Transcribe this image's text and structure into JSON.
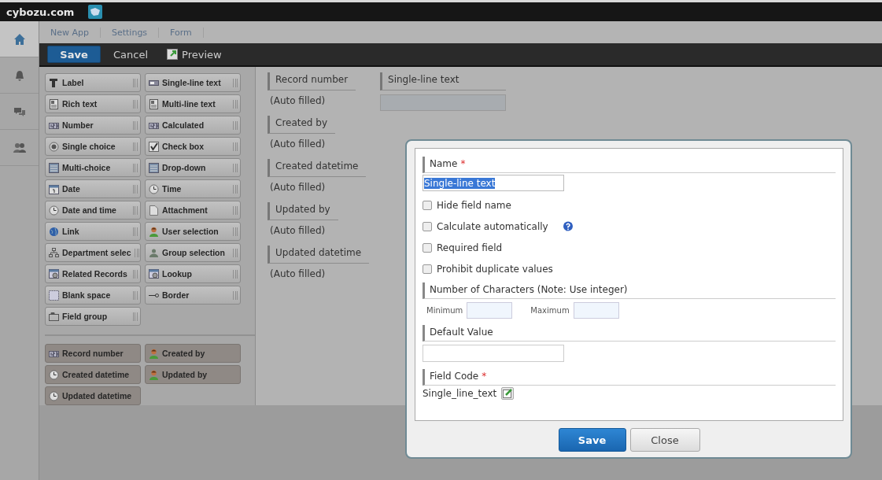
{
  "topbar": {
    "logo": "cybozu.com"
  },
  "sidenav": [
    {
      "kind": "home",
      "selected": true
    },
    {
      "kind": "bell",
      "selected": false
    },
    {
      "kind": "chat",
      "selected": false
    },
    {
      "kind": "people",
      "selected": false
    }
  ],
  "breadcrumb": [
    "New App",
    "Settings",
    "Form"
  ],
  "toolbar": {
    "save": "Save",
    "cancel": "Cancel",
    "preview": "Preview"
  },
  "palette": {
    "fields": [
      {
        "label": "Label",
        "kind": "label"
      },
      {
        "label": "Single-line text",
        "kind": "text"
      },
      {
        "label": "Rich text",
        "kind": "doc"
      },
      {
        "label": "Multi-line text",
        "kind": "doc"
      },
      {
        "label": "Number",
        "kind": "number"
      },
      {
        "label": "Calculated",
        "kind": "number"
      },
      {
        "label": "Single choice",
        "kind": "radio"
      },
      {
        "label": "Check box",
        "kind": "check"
      },
      {
        "label": "Multi-choice",
        "kind": "list"
      },
      {
        "label": "Drop-down",
        "kind": "list"
      },
      {
        "label": "Date",
        "kind": "calendar"
      },
      {
        "label": "Time",
        "kind": "clock"
      },
      {
        "label": "Date and time",
        "kind": "clock"
      },
      {
        "label": "Attachment",
        "kind": "file"
      },
      {
        "label": "Link",
        "kind": "globe"
      },
      {
        "label": "User selection",
        "kind": "person"
      },
      {
        "label": "Department selec",
        "kind": "org"
      },
      {
        "label": "Group selection",
        "kind": "group"
      },
      {
        "label": "Related Records",
        "kind": "table"
      },
      {
        "label": "Lookup",
        "kind": "table"
      },
      {
        "label": "Blank space",
        "kind": "blank"
      },
      {
        "label": "Border",
        "kind": "border"
      },
      {
        "label": "Field group",
        "kind": "folder"
      }
    ],
    "system_fields": [
      {
        "label": "Record number",
        "kind": "number"
      },
      {
        "label": "Created by",
        "kind": "person"
      },
      {
        "label": "Created datetime",
        "kind": "clock"
      },
      {
        "label": "Updated by",
        "kind": "person"
      },
      {
        "label": "Updated datetime",
        "kind": "clock"
      }
    ]
  },
  "form": {
    "auto_fields": [
      {
        "label": "Record number",
        "value": "(Auto filled)"
      },
      {
        "label": "Created by",
        "value": "(Auto filled)"
      },
      {
        "label": "Created datetime",
        "value": "(Auto filled)"
      },
      {
        "label": "Updated by",
        "value": "(Auto filled)"
      },
      {
        "label": "Updated datetime",
        "value": "(Auto filled)"
      }
    ],
    "text_field": {
      "label": "Single-line text"
    }
  },
  "dialog": {
    "name": {
      "label": "Name",
      "required_mark": "*",
      "value": "Single-line text",
      "text_selected": true
    },
    "options": [
      {
        "label": "Hide field name",
        "checked": false,
        "help": false
      },
      {
        "label": "Calculate automatically",
        "checked": false,
        "help": true
      },
      {
        "label": "Required field",
        "checked": false,
        "help": false
      },
      {
        "label": "Prohibit duplicate values",
        "checked": false,
        "help": false
      }
    ],
    "characters": {
      "label": "Number of Characters (Note: Use integer)",
      "minimum": "Minimum",
      "maximum": "Maximum"
    },
    "default_value": {
      "label": "Default Value"
    },
    "field_code": {
      "label": "Field Code",
      "required_mark": "*",
      "value": "Single_line_text"
    },
    "buttons": {
      "save": "Save",
      "close": "Close"
    }
  }
}
